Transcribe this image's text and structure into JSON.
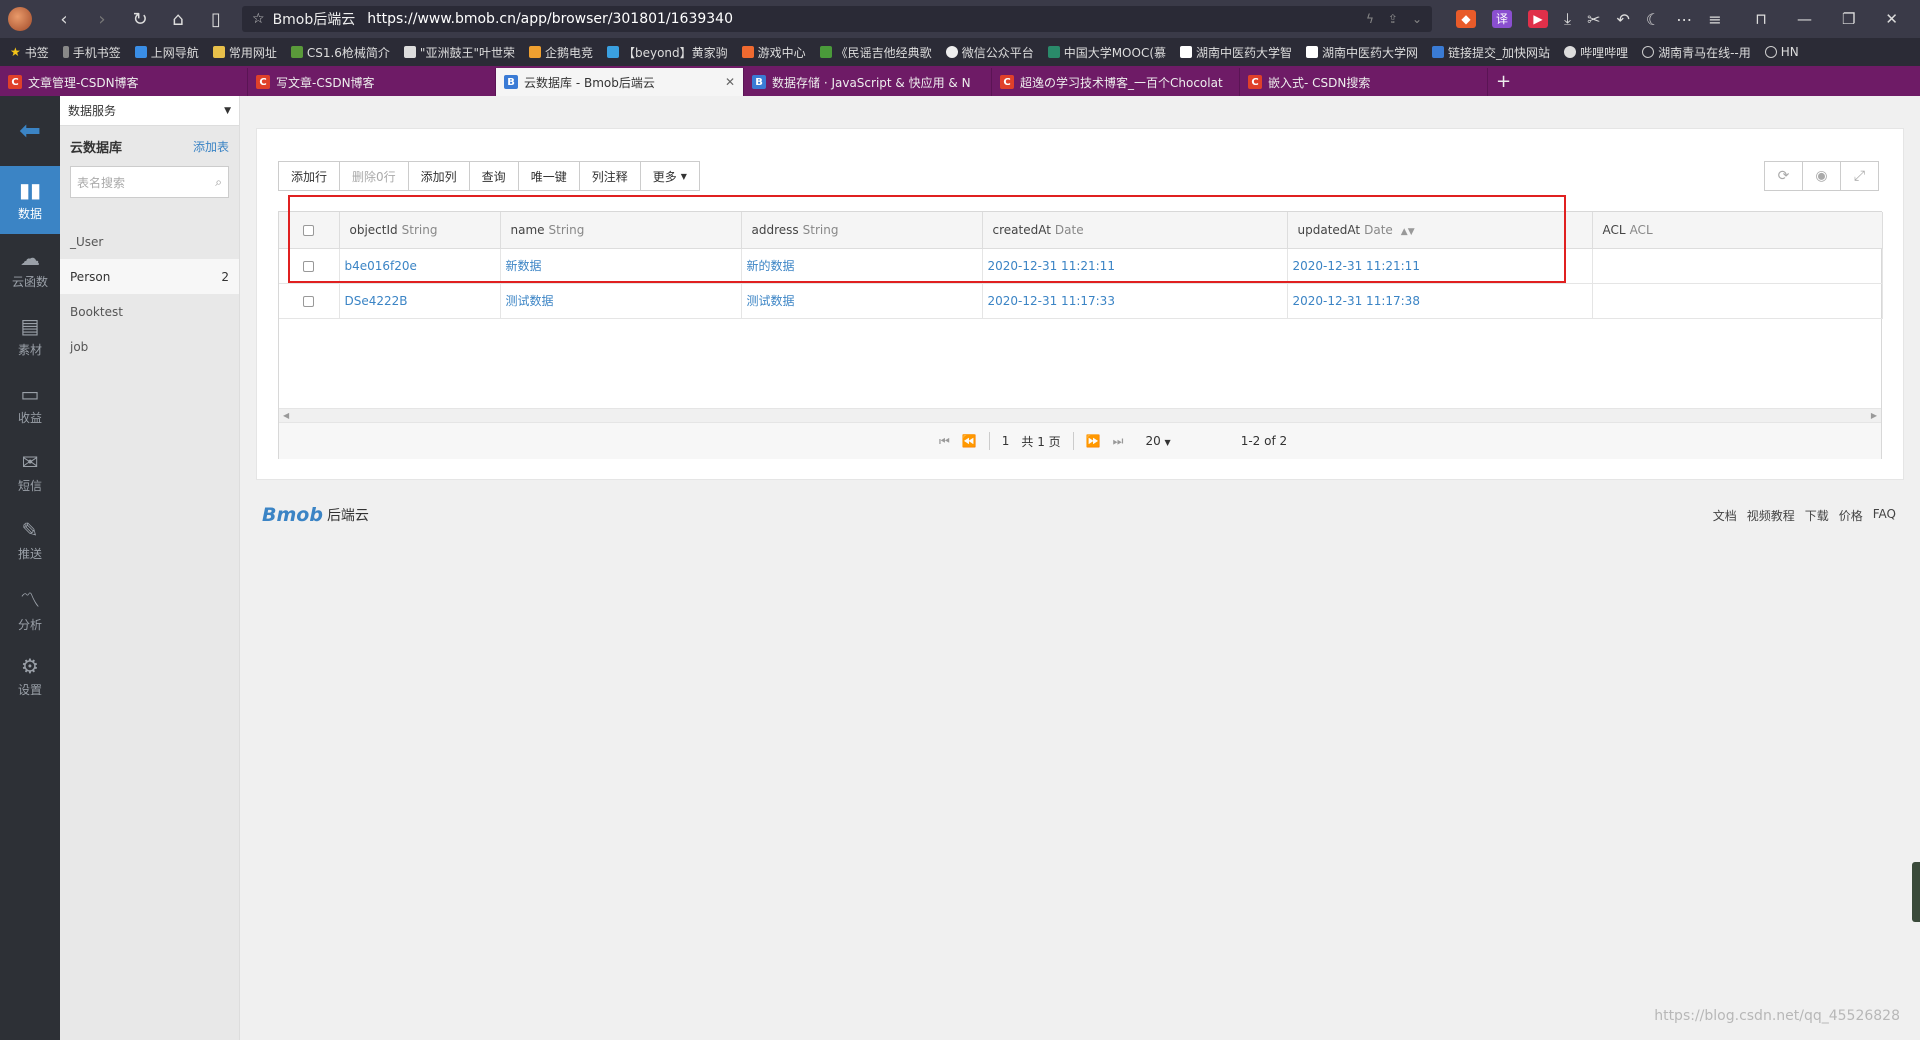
{
  "browser": {
    "site_name": "Bmob后端云",
    "url": "https://www.bmob.cn/app/browser/301801/1639340",
    "bookmarks": [
      "书签",
      "手机书签",
      "上网导航",
      "常用网址",
      "CS1.6枪械简介",
      "\"亚洲鼓王\"叶世荣",
      "企鹅电竞",
      "【beyond】黄家驹",
      "游戏中心",
      "《民谣吉他经典歌",
      "微信公众平台",
      "中国大学MOOC(慕",
      "湖南中医药大学智",
      "湖南中医药大学网",
      "链接提交_加快网站",
      "哔哩哔哩",
      "湖南青马在线--用",
      "HN"
    ],
    "tabs": [
      {
        "title": "文章管理-CSDN博客",
        "icon": "csdn",
        "active": false
      },
      {
        "title": "写文章-CSDN博客",
        "icon": "csdn",
        "active": false
      },
      {
        "title": "云数据库 - Bmob后端云",
        "icon": "bmob",
        "active": true
      },
      {
        "title": "数据存储 · JavaScript & 快应用 & N",
        "icon": "bmob",
        "active": false
      },
      {
        "title": "超逸の学习技术博客_一百个Chocolat",
        "icon": "csdn",
        "active": false
      },
      {
        "title": "嵌入式- CSDN搜索",
        "icon": "csdn",
        "active": false
      }
    ]
  },
  "leftnav": [
    {
      "label": "数据",
      "icon": "bar-chart-icon",
      "active": true
    },
    {
      "label": "云函数",
      "icon": "cloud-icon",
      "active": false
    },
    {
      "label": "素材",
      "icon": "file-icon",
      "active": false
    },
    {
      "label": "收益",
      "icon": "card-icon",
      "active": false
    },
    {
      "label": "短信",
      "icon": "mail-icon",
      "active": false
    },
    {
      "label": "推送",
      "icon": "edit-icon",
      "active": false
    },
    {
      "label": "分析",
      "icon": "line-chart-icon",
      "active": false
    },
    {
      "label": "设置",
      "icon": "gear-icon",
      "active": false
    }
  ],
  "sidebar": {
    "service_select": "数据服务",
    "section_title": "云数据库",
    "add_table": "添加表",
    "search_placeholder": "表名搜索",
    "tables": [
      {
        "name": "_User",
        "count": ""
      },
      {
        "name": "Person",
        "count": "2"
      },
      {
        "name": "Booktest",
        "count": ""
      },
      {
        "name": "job",
        "count": ""
      }
    ]
  },
  "toolbar": {
    "add_row": "添加行",
    "delete_rows": "删除0行",
    "add_column": "添加列",
    "query": "查询",
    "unique_key": "唯一键",
    "column_note": "列注释",
    "more": "更多"
  },
  "table": {
    "columns": [
      {
        "name": "objectId",
        "type": "String"
      },
      {
        "name": "name",
        "type": "String"
      },
      {
        "name": "address",
        "type": "String"
      },
      {
        "name": "createdAt",
        "type": "Date"
      },
      {
        "name": "updatedAt",
        "type": "Date"
      },
      {
        "name": "ACL",
        "type": "ACL"
      }
    ],
    "rows": [
      [
        "b4e016f20e",
        "新数据",
        "新的数据",
        "2020-12-31 11:21:11",
        "2020-12-31 11:21:11",
        ""
      ],
      [
        "DSe4222B",
        "测试数据",
        "测试数据",
        "2020-12-31 11:17:33",
        "2020-12-31 11:17:38",
        ""
      ]
    ]
  },
  "pager": {
    "page": "1",
    "total_pages": "共 1 页",
    "page_size": "20",
    "summary": "1-2 of 2"
  },
  "footer": {
    "logo": "Bmob",
    "logo_sub": "后端云",
    "links": [
      "文档",
      "视频教程",
      "下载",
      "价格",
      "FAQ"
    ]
  },
  "watermark": "https://blog.csdn.net/qq_45526828"
}
